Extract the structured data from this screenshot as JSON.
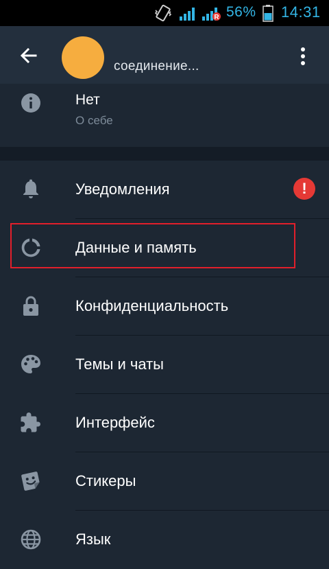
{
  "status_bar": {
    "battery_percent": "56%",
    "time": "14:31",
    "icons": [
      "vibrate-icon",
      "signal-icon",
      "signal-roaming-icon",
      "battery-icon"
    ],
    "accent_color": "#33b5e5"
  },
  "app_bar": {
    "status_text": "соединение...",
    "avatar_color": "#f6ad3f",
    "icons": [
      "back-arrow-icon",
      "more-vert-icon"
    ]
  },
  "bio": {
    "value": "Нет",
    "label": "О себе",
    "icon": "info-icon"
  },
  "settings": {
    "items": [
      {
        "label": "Уведомления",
        "icon": "bell-icon",
        "badge": "!"
      },
      {
        "label": "Данные и память",
        "icon": "data-usage-icon"
      },
      {
        "label": "Конфиденциальность",
        "icon": "lock-icon"
      },
      {
        "label": "Темы и чаты",
        "icon": "palette-icon"
      },
      {
        "label": "Интерфейс",
        "icon": "puzzle-icon"
      },
      {
        "label": "Стикеры",
        "icon": "sticker-icon"
      },
      {
        "label": "Язык",
        "icon": "globe-icon"
      }
    ]
  },
  "colors": {
    "background": "#1d2733",
    "app_bar": "#232f3d",
    "badge": "#e53935",
    "highlight_border": "#e21f2b"
  }
}
